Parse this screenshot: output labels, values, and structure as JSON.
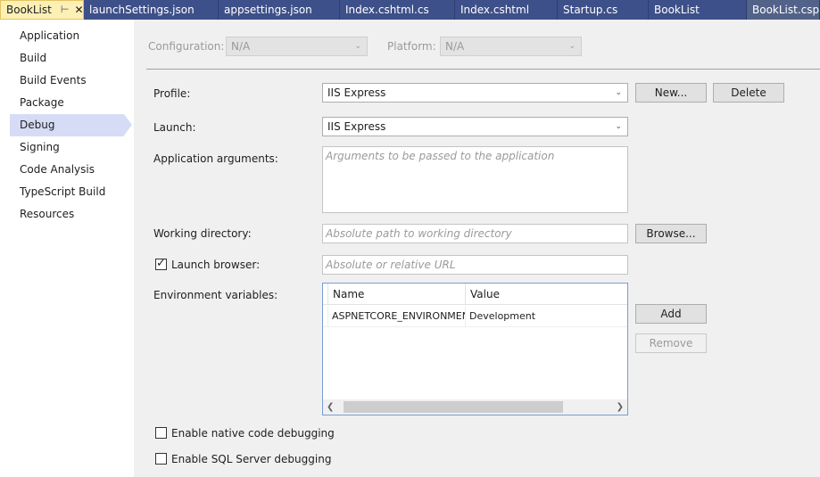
{
  "tabs": [
    {
      "label": "BookList",
      "active": true
    },
    {
      "label": "launchSettings.json"
    },
    {
      "label": "appsettings.json"
    },
    {
      "label": "Index.cshtml.cs"
    },
    {
      "label": "Index.cshtml"
    },
    {
      "label": "Startup.cs"
    },
    {
      "label": "BookList"
    },
    {
      "label": "BookList.cspro"
    }
  ],
  "tab_icons": {
    "pin": "pin-icon",
    "close": "close-icon"
  },
  "nav": {
    "items": [
      "Application",
      "Build",
      "Build Events",
      "Package",
      "Debug",
      "Signing",
      "Code Analysis",
      "TypeScript Build",
      "Resources"
    ],
    "selected": "Debug"
  },
  "config": {
    "configuration_label": "Configuration:",
    "configuration_value": "N/A",
    "platform_label": "Platform:",
    "platform_value": "N/A"
  },
  "profile": {
    "label": "Profile:",
    "value": "IIS Express",
    "new_button": "New...",
    "delete_button": "Delete"
  },
  "launch": {
    "label": "Launch:",
    "value": "IIS Express"
  },
  "app_args": {
    "label": "Application arguments:",
    "placeholder": "Arguments to be passed to the application"
  },
  "working_dir": {
    "label": "Working directory:",
    "placeholder": "Absolute path to working directory",
    "browse_button": "Browse..."
  },
  "launch_browser": {
    "label": "Launch browser:",
    "checked": true,
    "placeholder": "Absolute or relative URL"
  },
  "env_vars": {
    "label": "Environment variables:",
    "columns": [
      "Name",
      "Value"
    ],
    "rows": [
      {
        "name": "ASPNETCORE_ENVIRONMENT",
        "value": "Development"
      }
    ],
    "add_button": "Add",
    "remove_button": "Remove"
  },
  "options": {
    "native_debugging": "Enable native code debugging",
    "sql_debugging": "Enable SQL Server debugging"
  },
  "colors": {
    "tabstrip": "#2d3e6e",
    "active_tab": "#fcf0b5",
    "nav_selected": "#d6dcf5"
  }
}
